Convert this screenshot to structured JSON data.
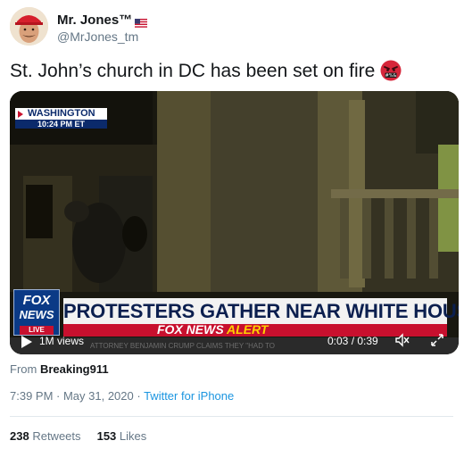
{
  "user": {
    "display_name": "Mr. Jones™",
    "handle": "@MrJones_tm",
    "flag_icon": "us-flag-icon"
  },
  "tweet": {
    "text": "St. John’s church in DC has been set on fire",
    "emoji_icon": "angry-face-with-symbols-emoji"
  },
  "video": {
    "location": "WASHINGTON",
    "location_time": "10:24 PM ET",
    "logo_line1": "FOX",
    "logo_line2": "NEWS",
    "logo_live": "LIVE",
    "headline": "PROTESTERS GATHER NEAR WHITE HOUSE",
    "alert_brand": "FOX NEWS",
    "alert_word": "ALERT",
    "ticker": "ATTORNEY BENJAMIN CRUMP CLAIMS THEY \"HAD TO",
    "views": "1M views",
    "time_display": "0:03 / 0:39"
  },
  "source": {
    "prefix": "From",
    "account": "Breaking911"
  },
  "meta": {
    "timestamp": "7:39 PM · May 31, 2020 ·",
    "client": "Twitter for iPhone"
  },
  "stats": {
    "retweets_count": "238",
    "retweets_label": "Retweets",
    "likes_count": "153",
    "likes_label": "Likes"
  },
  "colors": {
    "link": "#1b95e0",
    "secondary_text": "#657786",
    "fox_red": "#c8102e",
    "fox_blue": "#0b2a6b"
  }
}
